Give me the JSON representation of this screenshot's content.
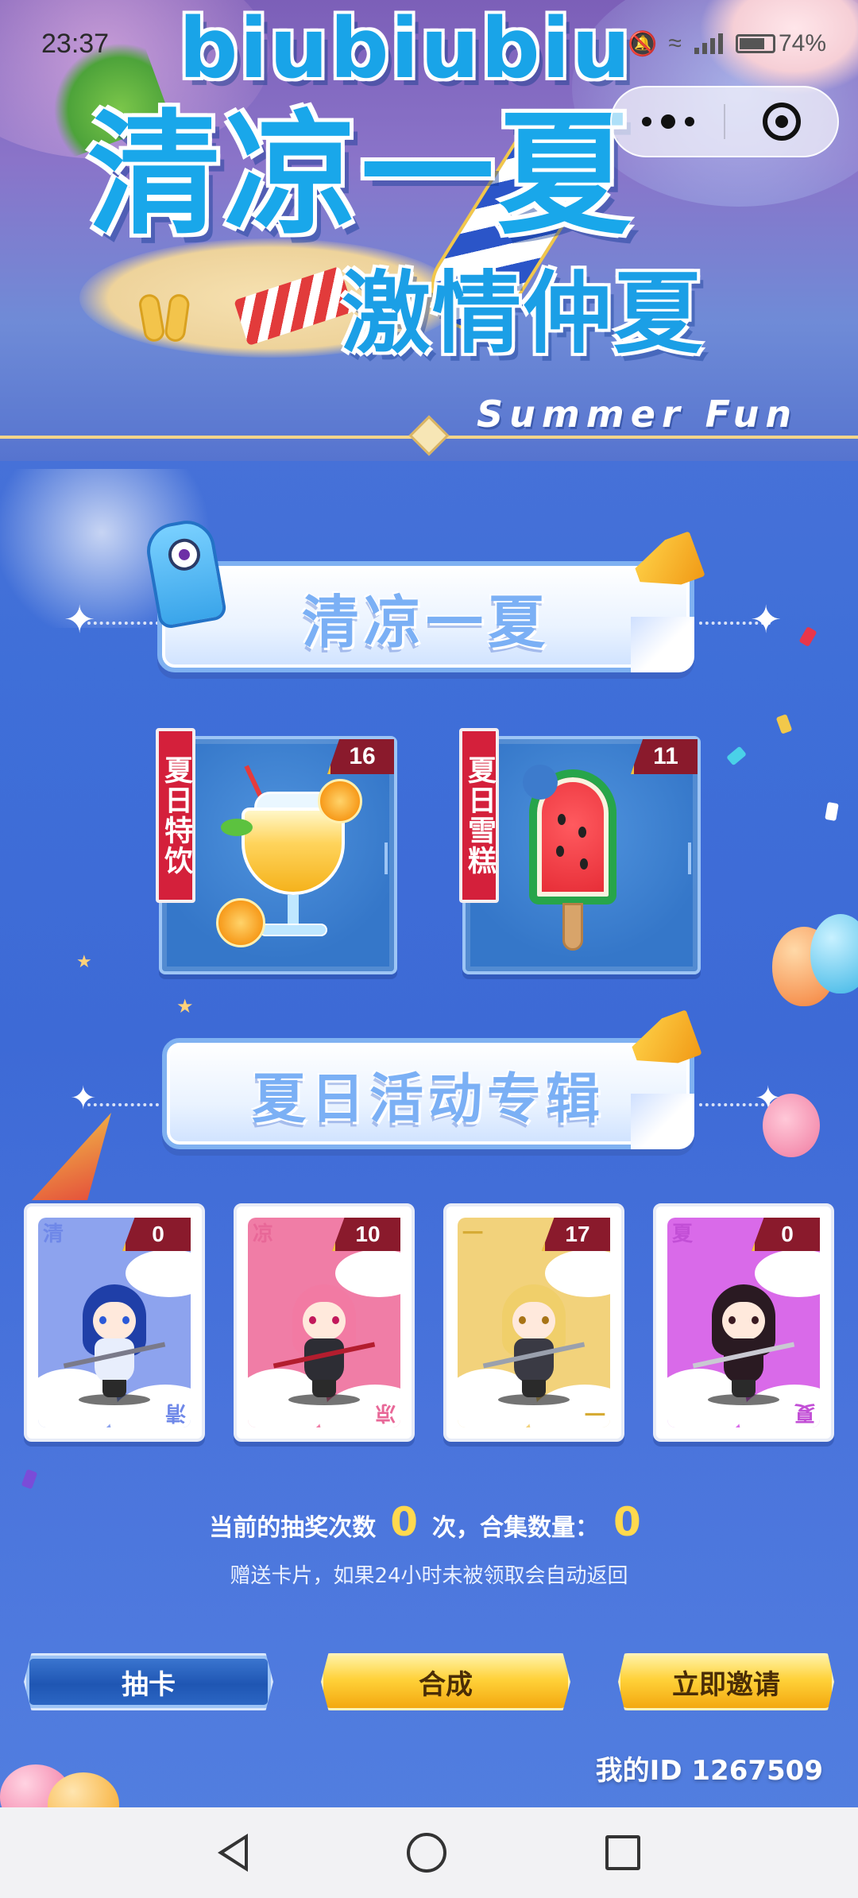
{
  "status_bar": {
    "time": "23:37",
    "battery": "74%"
  },
  "banner": {
    "latin_title": "biubiubiu",
    "title_line1": "清凉一夏",
    "title_line2": "激情仲夏",
    "subtitle": "Summer Fun"
  },
  "section1": {
    "title": "清凉一夏",
    "items": [
      {
        "label": "夏日特饮",
        "count": "16",
        "icon": "drink-icon"
      },
      {
        "label": "夏日雪糕",
        "count": "11",
        "icon": "popsicle-icon"
      }
    ]
  },
  "section2": {
    "title": "夏日活动专辑",
    "cards": [
      {
        "char": "清",
        "count": "0",
        "color": "#8da3ee"
      },
      {
        "char": "凉",
        "count": "10",
        "color": "#f07da6"
      },
      {
        "char": "一",
        "count": "17",
        "color": "#f2d27b"
      },
      {
        "char": "夏",
        "count": "0",
        "color": "#d96ae9"
      }
    ]
  },
  "info": {
    "draw_label": "当前的抽奖次数",
    "draw_count": "0",
    "draw_unit": "次，合集数量：",
    "collection_count": "0",
    "note": "赠送卡片，如果24小时未被领取会自动返回"
  },
  "buttons": {
    "draw": "抽卡",
    "merge": "合成",
    "invite": "立即邀请"
  },
  "my_id": "我的ID 1267509",
  "colors": {
    "accent_gold": "#ffd94e",
    "count_badge": "#8a1a2c",
    "ribbon_red": "#d4203b"
  }
}
